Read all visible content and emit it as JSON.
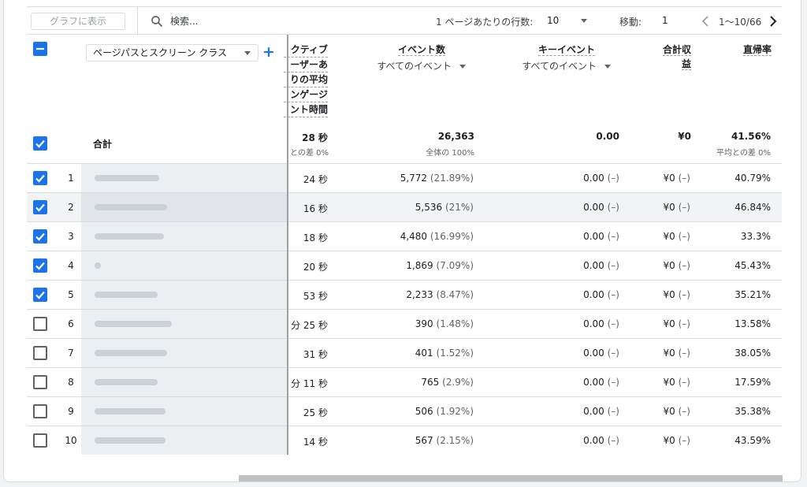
{
  "toolbar": {
    "chart_button": "グラフに表示",
    "search_placeholder": "検索...",
    "rows_per_page_label": "1 ページあたりの行数:",
    "rows_per_page_value": "10",
    "goto_label": "移動:",
    "goto_value": "1",
    "range": "1〜10/66"
  },
  "header": {
    "dimension": "ページパスとスクリーン クラス",
    "add_icon": "+",
    "col_engagement": [
      "クティブ",
      "ーザーあ",
      "りの平均",
      "ンゲージ",
      "ント時間"
    ],
    "col_events": "イベント数",
    "col_events_sub": "すべてのイベント",
    "col_key_events": "キーイベント",
    "col_key_events_sub": "すべてのイベント",
    "col_revenue_1": "合計収",
    "col_revenue_2": "益",
    "col_bounce": "直帰率"
  },
  "totals": {
    "label": "合計",
    "engagement": "28 秒",
    "engagement_sub": "との差 0%",
    "events": "26,363",
    "events_sub": "全体の 100%",
    "key_events": "0.00",
    "revenue": "¥0",
    "bounce": "41.56%",
    "bounce_sub": "平均との差 0%"
  },
  "rows": [
    {
      "idx": "1",
      "checked": true,
      "engagement": "24 秒",
      "events": "5,772",
      "events_pct": "(21.89%)",
      "key_events": "0.00",
      "key_pct": "(–)",
      "revenue": "¥0",
      "rev_pct": "(–)",
      "bounce": "40.79%"
    },
    {
      "idx": "2",
      "checked": true,
      "engagement": "16 秒",
      "events": "5,536",
      "events_pct": "(21%)",
      "key_events": "0.00",
      "key_pct": "(–)",
      "revenue": "¥0",
      "rev_pct": "(–)",
      "bounce": "46.84%"
    },
    {
      "idx": "3",
      "checked": true,
      "engagement": "18 秒",
      "events": "4,480",
      "events_pct": "(16.99%)",
      "key_events": "0.00",
      "key_pct": "(–)",
      "revenue": "¥0",
      "rev_pct": "(–)",
      "bounce": "33.3%"
    },
    {
      "idx": "4",
      "checked": true,
      "engagement": "20 秒",
      "events": "1,869",
      "events_pct": "(7.09%)",
      "key_events": "0.00",
      "key_pct": "(–)",
      "revenue": "¥0",
      "rev_pct": "(–)",
      "bounce": "45.43%"
    },
    {
      "idx": "5",
      "checked": true,
      "engagement": "53 秒",
      "events": "2,233",
      "events_pct": "(8.47%)",
      "key_events": "0.00",
      "key_pct": "(–)",
      "revenue": "¥0",
      "rev_pct": "(–)",
      "bounce": "35.21%"
    },
    {
      "idx": "6",
      "checked": false,
      "engagement": "分 25 秒",
      "events": "390",
      "events_pct": "(1.48%)",
      "key_events": "0.00",
      "key_pct": "(–)",
      "revenue": "¥0",
      "rev_pct": "(–)",
      "bounce": "13.58%"
    },
    {
      "idx": "7",
      "checked": false,
      "engagement": "31 秒",
      "events": "401",
      "events_pct": "(1.52%)",
      "key_events": "0.00",
      "key_pct": "(–)",
      "revenue": "¥0",
      "rev_pct": "(–)",
      "bounce": "38.05%"
    },
    {
      "idx": "8",
      "checked": false,
      "engagement": "分 11 秒",
      "events": "765",
      "events_pct": "(2.9%)",
      "key_events": "0.00",
      "key_pct": "(–)",
      "revenue": "¥0",
      "rev_pct": "(–)",
      "bounce": "17.59%"
    },
    {
      "idx": "9",
      "checked": false,
      "engagement": "25 秒",
      "events": "506",
      "events_pct": "(1.92%)",
      "key_events": "0.00",
      "key_pct": "(–)",
      "revenue": "¥0",
      "rev_pct": "(–)",
      "bounce": "35.38%"
    },
    {
      "idx": "10",
      "checked": false,
      "engagement": "14 秒",
      "events": "567",
      "events_pct": "(2.15%)",
      "key_events": "0.00",
      "key_pct": "(–)",
      "revenue": "¥0",
      "rev_pct": "(–)",
      "bounce": "43.59%"
    }
  ],
  "colors": {
    "accent": "#1a73e8",
    "border": "#dadce0",
    "highlight": "#f1f3f4"
  },
  "icons": {
    "search": "search-icon",
    "prev": "chevron-left-icon",
    "next": "chevron-right-icon",
    "checkbox": "checkbox-icon"
  }
}
